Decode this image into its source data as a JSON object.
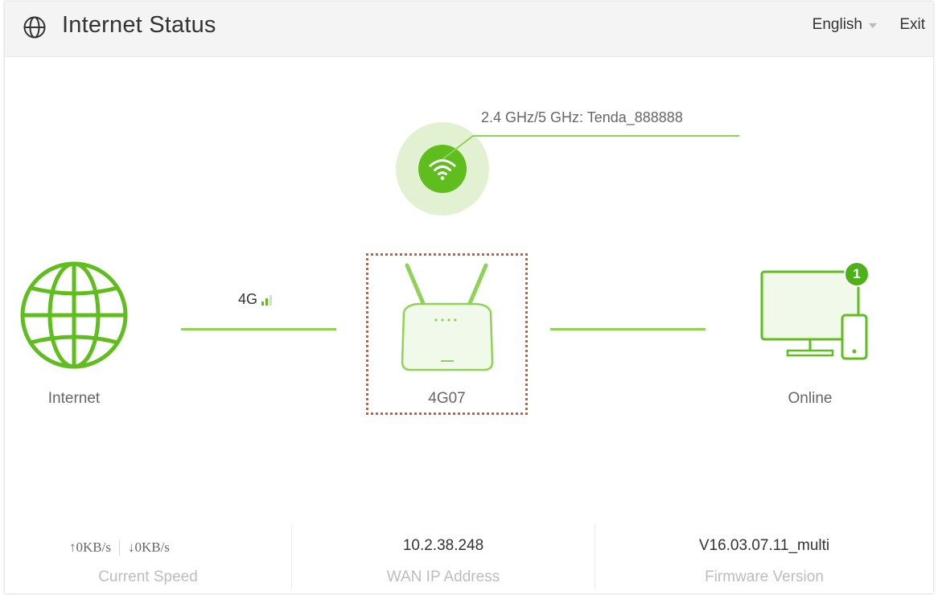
{
  "header": {
    "title": "Internet Status",
    "language": "English",
    "exit_label": "Exit",
    "title_icon": "globe-icon"
  },
  "wifi": {
    "ssid_text": "2.4 GHz/5 GHz: Tenda_888888",
    "icon": "wifi-icon"
  },
  "internet": {
    "label": "Internet",
    "icon": "globe-icon",
    "connection_type": "4G",
    "signal_bars_active": 2,
    "signal_bars_total": 3
  },
  "router": {
    "name": "4G07",
    "icon": "router-icon"
  },
  "clients": {
    "label": "Online",
    "count": "1",
    "icon": "monitor-phone-icon"
  },
  "stats": {
    "upload": "0KB/s",
    "download": "0KB/s",
    "speed_label": "Current Speed",
    "wan_ip": "10.2.38.248",
    "wan_ip_label": "WAN IP Address",
    "firmware": "V16.03.07.11_multi",
    "firmware_label": "Firmware Version"
  },
  "colors": {
    "accent_green": "#5fbd1d",
    "line_green": "#8ed356",
    "highlight_orange": "#e0562b"
  }
}
